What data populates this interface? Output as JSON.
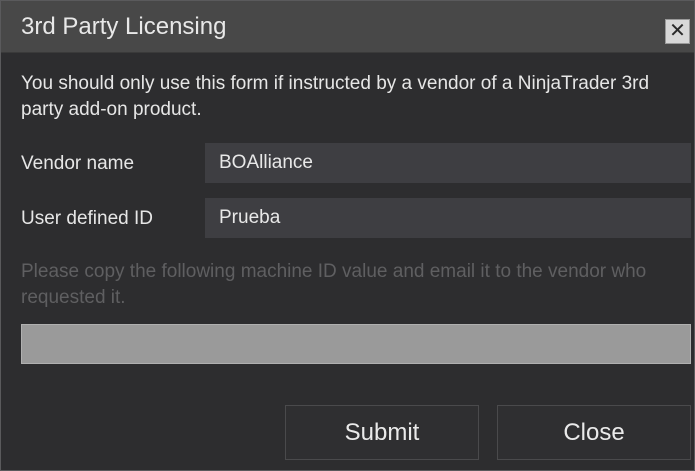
{
  "window": {
    "title": "3rd Party Licensing",
    "close_glyph": "✕"
  },
  "form": {
    "intro": "You should only use this form if instructed by a vendor of a NinjaTrader 3rd party add-on product.",
    "vendor_name_label": "Vendor name",
    "vendor_name_value": "BOAlliance",
    "user_id_label": "User defined ID",
    "user_id_value": "Prueba",
    "hint": "Please copy the following machine ID value and email it to the vendor who requested it.",
    "machine_id_value": ""
  },
  "buttons": {
    "submit_label": "Submit",
    "close_label": "Close"
  },
  "colors": {
    "titlebar": "#484848",
    "background": "#2d2d2f",
    "field": "#3e3e42",
    "machine_id_field": "#9a9a9a",
    "hint_text": "#5f5f61"
  }
}
